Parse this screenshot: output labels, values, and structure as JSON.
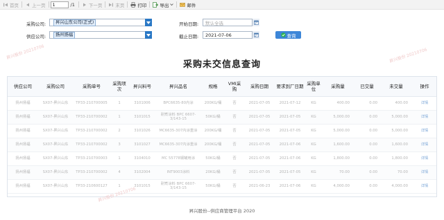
{
  "toolbar": {
    "first_label": "首页",
    "prev_label": "上一页",
    "page_value": "1",
    "page_total": "/1",
    "next_label": "下一页",
    "last_label": "末页",
    "print_label": "打印",
    "export_label": "导出",
    "mail_label": "邮件"
  },
  "filters": {
    "buyer_label": "采购公司:",
    "buyer_value": "昇兴山东公司(正式)",
    "supplier_label": "供应公司:",
    "supplier_value": "扬州扬福",
    "start_label": "开始日期:",
    "start_placeholder": "默认全选",
    "end_label": "截止日期:",
    "end_value": "2021-07-06",
    "query_label": "查询"
  },
  "title": "采购未交信息查询",
  "table": {
    "headers": [
      "供应公司",
      "采购公司",
      "采购单号",
      "采购项次",
      "昇兴料号",
      "昇兴品名",
      "规格",
      "VMI采购",
      "采购日期",
      "要求到厂日期",
      "采购单位",
      "采购量",
      "已交量",
      "未交量",
      "操作"
    ],
    "rows": [
      [
        "扬州扬福",
        "SX07-昇兴山东",
        "TP33-210700005",
        "1",
        "3101006",
        "BPC6635-80内涂",
        "200KG/桶",
        "否",
        "2021-07-05",
        "2021-07-12",
        "KG",
        "400.00",
        "0.00",
        "400.00",
        "详情"
      ],
      [
        "扬州扬福",
        "SX07-昇兴山东",
        "TP33-210700002",
        "1",
        "3101015",
        "耐煮涂料 BPC 6607-3/143-15",
        "50KG/桶",
        "否",
        "2021-07-05",
        "2021-07-05",
        "KG",
        "5,000.00",
        "0.00",
        "5,000.00",
        "详情"
      ],
      [
        "扬州扬福",
        "SX07-昇兴山东",
        "TP33-210700002",
        "2",
        "3101026",
        "MC6635-307内涂重涂",
        "200KG/桶",
        "否",
        "2021-07-05",
        "2021-07-05",
        "KG",
        "5,000.00",
        "0.00",
        "5,000.00",
        "详情"
      ],
      [
        "扬州扬福",
        "SX07-昇兴山东",
        "TP33-210700002",
        "3",
        "3101027",
        "MC6635-307内涂重涂",
        "200KG/桶",
        "否",
        "2021-07-05",
        "2021-07-06",
        "KG",
        "1,600.00",
        "0.00",
        "1,600.00",
        "详情"
      ],
      [
        "扬州扬福",
        "SX07-昇兴山东",
        "TP33-210700003",
        "1",
        "3104010",
        "MC 55778钢罐用涂",
        "50KG/桶",
        "否",
        "2021-07-05",
        "2021-07-06",
        "KG",
        "1,800.00",
        "0.00",
        "1,800.00",
        "详情"
      ],
      [
        "扬州扬福",
        "SX07-昇兴山东",
        "TP33-210700002",
        "4",
        "3102004",
        "INT9003涂料",
        "20KG/桶",
        "否",
        "2021-07-05",
        "2021-07-05",
        "KG",
        "70.00",
        "0.00",
        "70.00",
        "详情"
      ],
      [
        "扬州扬福",
        "SX07-昇兴山东",
        "TP33-210600127",
        "1",
        "3101015",
        "耐煮涂料 BPC 6607-3/143-15",
        "50KG/桶",
        "否",
        "2021-06-23",
        "2021-07-06",
        "KG",
        "4,000.00",
        "0.00",
        "4,000.00",
        "详情"
      ]
    ]
  },
  "footer": "昇兴股份--供应商管理平台 2020",
  "watermark_text": "昇兴股份 20210706",
  "colors": {
    "accent": "#2a78c5",
    "query": "#3d86d8",
    "link": "#7ea8d8"
  }
}
